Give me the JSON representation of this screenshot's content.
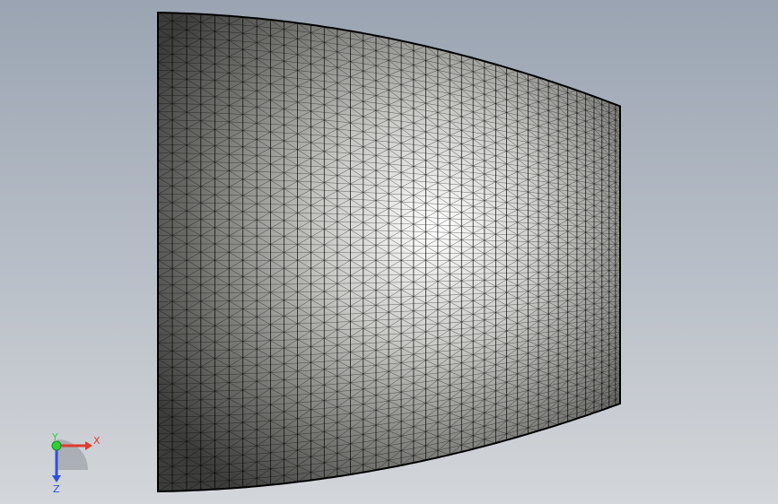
{
  "viewport": {
    "background_top": "#9aa4b2",
    "background_bottom": "#d3d6da",
    "mesh_line_color": "#000000"
  },
  "triad": {
    "x_label": "X",
    "y_label": "Y",
    "z_label": "Z",
    "x_color": "#e03a2f",
    "y_color": "#2fcf3a",
    "z_color": "#2f4fe0"
  }
}
